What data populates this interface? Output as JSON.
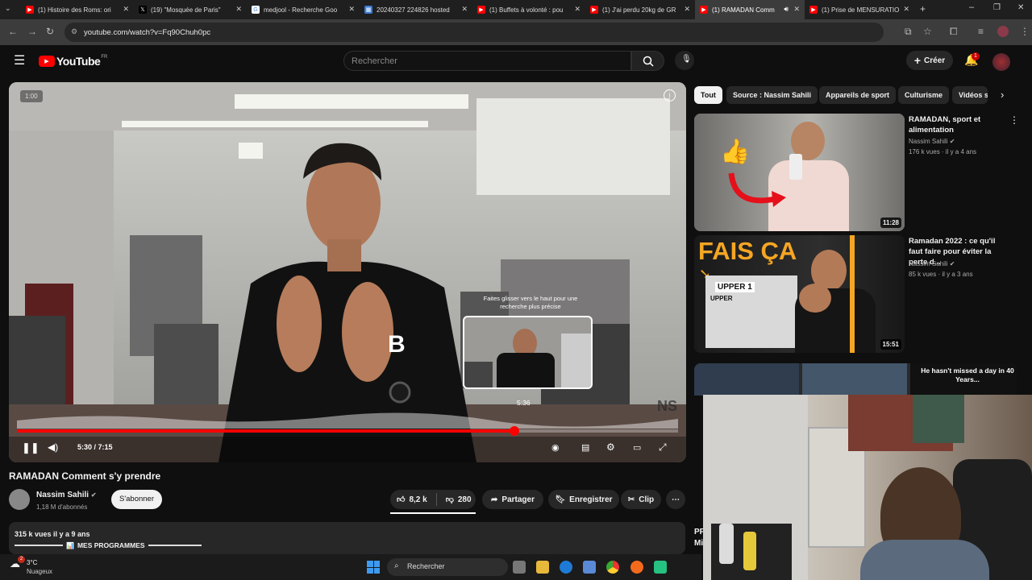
{
  "browser": {
    "tabs": [
      {
        "title": "(1) Histoire des Roms: ori",
        "icon": "youtube-icon",
        "active": false
      },
      {
        "title": "(19) \"Mosquée de Paris\"",
        "icon": "x-icon",
        "active": false
      },
      {
        "title": "medjool - Recherche Goo",
        "icon": "google-icon",
        "active": false
      },
      {
        "title": "20240327 224826 hosted",
        "icon": "image-icon",
        "active": false
      },
      {
        "title": "(1) Buffets à volonté : pou",
        "icon": "youtube-icon",
        "active": false
      },
      {
        "title": "(1) J'ai perdu 20kg de GR",
        "icon": "youtube-icon",
        "active": false
      },
      {
        "title": "(1) RAMADAN Comm",
        "icon": "youtube-icon",
        "active": true
      },
      {
        "title": "(1) Prise de MENSURATIO",
        "icon": "youtube-icon",
        "active": false
      }
    ],
    "url": "youtube.com/watch?v=Fq90Chuh0pc"
  },
  "youtube": {
    "logo": "YouTube",
    "region": "FR",
    "search_placeholder": "Rechercher",
    "create_label": "Créer",
    "notif_count": "1"
  },
  "player": {
    "badge_time": "1:00",
    "hint": "Faites glisser vers le haut pour une recherche plus précise",
    "preview_time": "5:36",
    "time_display": "5:30 / 7:15",
    "progress": 0.752,
    "watermark": "NS"
  },
  "video": {
    "title": "RAMADAN Comment s'y prendre",
    "channel": "Nassim Sahili",
    "subscribers": "1,18 M d'abonnés",
    "subscribe_label": "S'abonner",
    "likes": "8,2 k",
    "dislikes": "280",
    "share_label": "Partager",
    "save_label": "Enregistrer",
    "clip_label": "Clip",
    "views_line": "315 k vues  il y a 9 ans",
    "desc_line": "MES PROGRAMMES"
  },
  "chips": [
    "Tout",
    "Source : Nassim Sahili",
    "Appareils de sport",
    "Culturisme",
    "Vidéos s"
  ],
  "recommendations": [
    {
      "title": "RAMADAN, sport et alimentation",
      "channel": "Nassim Sahili",
      "meta": "176 k vues · il y a 4 ans",
      "duration": "11:28"
    },
    {
      "title": "Ramadan 2022 : ce qu'il faut faire pour éviter la perte d...",
      "channel": "Nassim Sahili",
      "meta": "85 k vues · il y a 3 ans",
      "duration": "15:51",
      "thumb_text": "FAIS ÇA",
      "thumb_sub": "UPPER 1",
      "thumb_sub2": "UPPER"
    },
    {
      "thumb_text": "He hasn't missed a day in 40 Years...",
      "title_frag1": "PF",
      "title_frag2": "Mi"
    }
  ],
  "taskbar": {
    "temp": "3°C",
    "weather": "Nuageux",
    "weather_badge": "2",
    "search": "Rechercher"
  },
  "colors": {
    "accent": "#ff0000",
    "bg": "#0f0f0f"
  }
}
